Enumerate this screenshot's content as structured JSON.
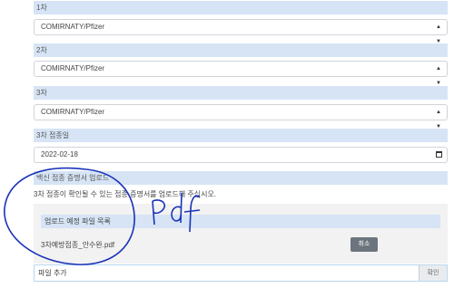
{
  "doses": [
    {
      "label": "1차",
      "value": "COMIRNATY/Pfizer"
    },
    {
      "label": "2차",
      "value": "COMIRNATY/Pfizer"
    },
    {
      "label": "3차",
      "value": "COMIRNATY/Pfizer"
    }
  ],
  "date": {
    "label": "3차 접종일",
    "value": "2022-02-18"
  },
  "upload": {
    "section_label": "백신 접종 증명서 업로드",
    "description": "3차 접종이 확인될 수 있는 접종 증명서를 업로드해 주십시오.",
    "list_header": "업로드 예정 파일 목록",
    "file_name": "3차예방접종_안수완.pdf",
    "cancel_label": "취소"
  },
  "confirm": {
    "input_value": "파일 추가",
    "button_label": "확인"
  },
  "annotation": {
    "handwritten_text": "Pdf"
  }
}
